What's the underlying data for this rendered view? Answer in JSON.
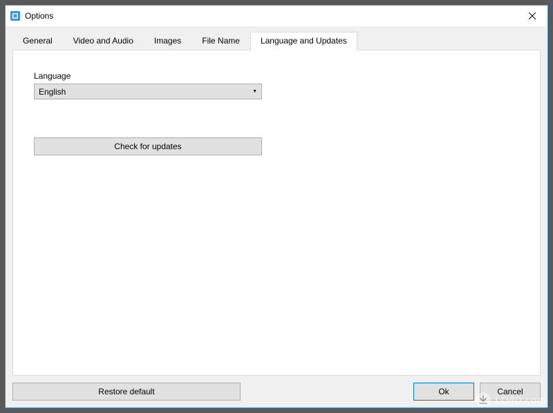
{
  "window": {
    "title": "Options"
  },
  "tabs": [
    {
      "label": "General"
    },
    {
      "label": "Video and Audio"
    },
    {
      "label": "Images"
    },
    {
      "label": "File Name"
    },
    {
      "label": "Language and Updates"
    }
  ],
  "active_tab_index": 4,
  "language": {
    "label": "Language",
    "selected": "English"
  },
  "buttons": {
    "check_updates": "Check for updates",
    "restore_default": "Restore default",
    "ok": "Ok",
    "cancel": "Cancel"
  },
  "watermark": {
    "text": "LO4D.com"
  }
}
